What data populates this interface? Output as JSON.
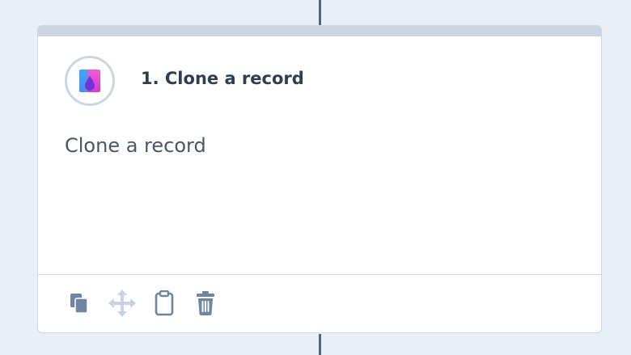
{
  "step": {
    "title": "1. Clone a record",
    "description": "Clone a record",
    "app_icon": "gradient-drop-logo-icon"
  },
  "toolbar": {
    "icons": [
      "copy-icon",
      "move-icon",
      "clipboard-icon",
      "trash-icon"
    ]
  },
  "colors": {
    "background": "#e9eef7",
    "connector": "#4a6585",
    "card_header_bar": "#ccd6e2",
    "title_text": "#2f3e50",
    "body_text": "#4a5565",
    "icon_active": "#6f86a3",
    "icon_disabled": "#c9d3df"
  }
}
